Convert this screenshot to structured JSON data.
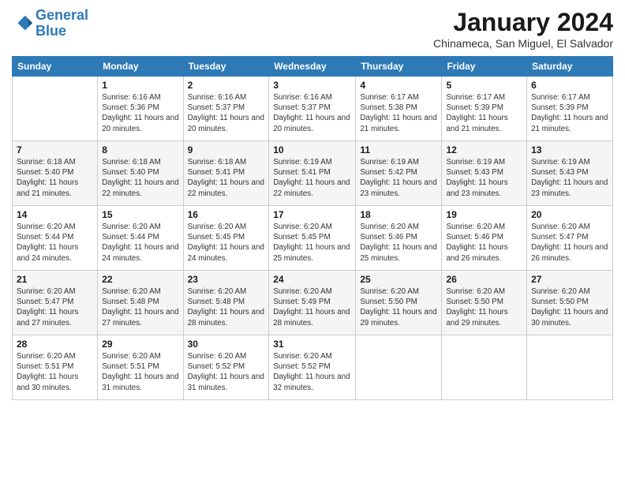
{
  "logo": {
    "line1": "General",
    "line2": "Blue"
  },
  "header": {
    "month": "January 2024",
    "location": "Chinameca, San Miguel, El Salvador"
  },
  "weekdays": [
    "Sunday",
    "Monday",
    "Tuesday",
    "Wednesday",
    "Thursday",
    "Friday",
    "Saturday"
  ],
  "weeks": [
    [
      {
        "day": "",
        "sunrise": "",
        "sunset": "",
        "daylight": ""
      },
      {
        "day": "1",
        "sunrise": "Sunrise: 6:16 AM",
        "sunset": "Sunset: 5:36 PM",
        "daylight": "Daylight: 11 hours and 20 minutes."
      },
      {
        "day": "2",
        "sunrise": "Sunrise: 6:16 AM",
        "sunset": "Sunset: 5:37 PM",
        "daylight": "Daylight: 11 hours and 20 minutes."
      },
      {
        "day": "3",
        "sunrise": "Sunrise: 6:16 AM",
        "sunset": "Sunset: 5:37 PM",
        "daylight": "Daylight: 11 hours and 20 minutes."
      },
      {
        "day": "4",
        "sunrise": "Sunrise: 6:17 AM",
        "sunset": "Sunset: 5:38 PM",
        "daylight": "Daylight: 11 hours and 21 minutes."
      },
      {
        "day": "5",
        "sunrise": "Sunrise: 6:17 AM",
        "sunset": "Sunset: 5:39 PM",
        "daylight": "Daylight: 11 hours and 21 minutes."
      },
      {
        "day": "6",
        "sunrise": "Sunrise: 6:17 AM",
        "sunset": "Sunset: 5:39 PM",
        "daylight": "Daylight: 11 hours and 21 minutes."
      }
    ],
    [
      {
        "day": "7",
        "sunrise": "Sunrise: 6:18 AM",
        "sunset": "Sunset: 5:40 PM",
        "daylight": "Daylight: 11 hours and 21 minutes."
      },
      {
        "day": "8",
        "sunrise": "Sunrise: 6:18 AM",
        "sunset": "Sunset: 5:40 PM",
        "daylight": "Daylight: 11 hours and 22 minutes."
      },
      {
        "day": "9",
        "sunrise": "Sunrise: 6:18 AM",
        "sunset": "Sunset: 5:41 PM",
        "daylight": "Daylight: 11 hours and 22 minutes."
      },
      {
        "day": "10",
        "sunrise": "Sunrise: 6:19 AM",
        "sunset": "Sunset: 5:41 PM",
        "daylight": "Daylight: 11 hours and 22 minutes."
      },
      {
        "day": "11",
        "sunrise": "Sunrise: 6:19 AM",
        "sunset": "Sunset: 5:42 PM",
        "daylight": "Daylight: 11 hours and 23 minutes."
      },
      {
        "day": "12",
        "sunrise": "Sunrise: 6:19 AM",
        "sunset": "Sunset: 5:43 PM",
        "daylight": "Daylight: 11 hours and 23 minutes."
      },
      {
        "day": "13",
        "sunrise": "Sunrise: 6:19 AM",
        "sunset": "Sunset: 5:43 PM",
        "daylight": "Daylight: 11 hours and 23 minutes."
      }
    ],
    [
      {
        "day": "14",
        "sunrise": "Sunrise: 6:20 AM",
        "sunset": "Sunset: 5:44 PM",
        "daylight": "Daylight: 11 hours and 24 minutes."
      },
      {
        "day": "15",
        "sunrise": "Sunrise: 6:20 AM",
        "sunset": "Sunset: 5:44 PM",
        "daylight": "Daylight: 11 hours and 24 minutes."
      },
      {
        "day": "16",
        "sunrise": "Sunrise: 6:20 AM",
        "sunset": "Sunset: 5:45 PM",
        "daylight": "Daylight: 11 hours and 24 minutes."
      },
      {
        "day": "17",
        "sunrise": "Sunrise: 6:20 AM",
        "sunset": "Sunset: 5:45 PM",
        "daylight": "Daylight: 11 hours and 25 minutes."
      },
      {
        "day": "18",
        "sunrise": "Sunrise: 6:20 AM",
        "sunset": "Sunset: 5:46 PM",
        "daylight": "Daylight: 11 hours and 25 minutes."
      },
      {
        "day": "19",
        "sunrise": "Sunrise: 6:20 AM",
        "sunset": "Sunset: 5:46 PM",
        "daylight": "Daylight: 11 hours and 26 minutes."
      },
      {
        "day": "20",
        "sunrise": "Sunrise: 6:20 AM",
        "sunset": "Sunset: 5:47 PM",
        "daylight": "Daylight: 11 hours and 26 minutes."
      }
    ],
    [
      {
        "day": "21",
        "sunrise": "Sunrise: 6:20 AM",
        "sunset": "Sunset: 5:47 PM",
        "daylight": "Daylight: 11 hours and 27 minutes."
      },
      {
        "day": "22",
        "sunrise": "Sunrise: 6:20 AM",
        "sunset": "Sunset: 5:48 PM",
        "daylight": "Daylight: 11 hours and 27 minutes."
      },
      {
        "day": "23",
        "sunrise": "Sunrise: 6:20 AM",
        "sunset": "Sunset: 5:48 PM",
        "daylight": "Daylight: 11 hours and 28 minutes."
      },
      {
        "day": "24",
        "sunrise": "Sunrise: 6:20 AM",
        "sunset": "Sunset: 5:49 PM",
        "daylight": "Daylight: 11 hours and 28 minutes."
      },
      {
        "day": "25",
        "sunrise": "Sunrise: 6:20 AM",
        "sunset": "Sunset: 5:50 PM",
        "daylight": "Daylight: 11 hours and 29 minutes."
      },
      {
        "day": "26",
        "sunrise": "Sunrise: 6:20 AM",
        "sunset": "Sunset: 5:50 PM",
        "daylight": "Daylight: 11 hours and 29 minutes."
      },
      {
        "day": "27",
        "sunrise": "Sunrise: 6:20 AM",
        "sunset": "Sunset: 5:50 PM",
        "daylight": "Daylight: 11 hours and 30 minutes."
      }
    ],
    [
      {
        "day": "28",
        "sunrise": "Sunrise: 6:20 AM",
        "sunset": "Sunset: 5:51 PM",
        "daylight": "Daylight: 11 hours and 30 minutes."
      },
      {
        "day": "29",
        "sunrise": "Sunrise: 6:20 AM",
        "sunset": "Sunset: 5:51 PM",
        "daylight": "Daylight: 11 hours and 31 minutes."
      },
      {
        "day": "30",
        "sunrise": "Sunrise: 6:20 AM",
        "sunset": "Sunset: 5:52 PM",
        "daylight": "Daylight: 11 hours and 31 minutes."
      },
      {
        "day": "31",
        "sunrise": "Sunrise: 6:20 AM",
        "sunset": "Sunset: 5:52 PM",
        "daylight": "Daylight: 11 hours and 32 minutes."
      },
      {
        "day": "",
        "sunrise": "",
        "sunset": "",
        "daylight": ""
      },
      {
        "day": "",
        "sunrise": "",
        "sunset": "",
        "daylight": ""
      },
      {
        "day": "",
        "sunrise": "",
        "sunset": "",
        "daylight": ""
      }
    ]
  ]
}
